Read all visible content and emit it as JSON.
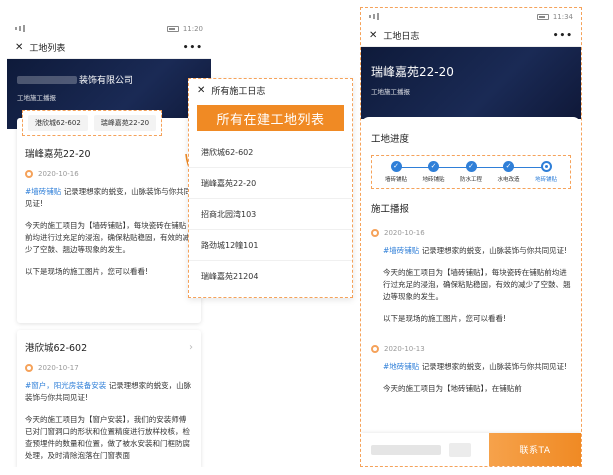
{
  "phone1": {
    "status_time": "11:20",
    "nav": {
      "close": "✕",
      "title": "工地列表",
      "more": "•••"
    },
    "banner": {
      "company": "装饰有限公司",
      "subtitle": "工地施工播报"
    },
    "chips": [
      "港欣城62-602",
      "瑞峰嘉苑22-20"
    ],
    "card1": {
      "title": "瑞峰嘉苑22-20",
      "date": "2020-10-16",
      "tag": "#墙砖铺贴",
      "tag_text": "记录理想家的蜕变，山脉装饰与你共同见证!",
      "line1": "你共同见证!",
      "para": "今天的施工项目为【墙砖铺贴】，每块瓷砖在铺贴前均进行过充足的浸泡，确保粘贴稳固，有效的减少了空鼓、翘边等现象的发生。",
      "para2": "以下是现场的施工图片，您可以看看!"
    },
    "card2": {
      "title": "港欣城62-602",
      "arrow": "›",
      "date": "2020-10-17",
      "tag": "#窗户，阳光房装备安装",
      "tag_text": "记录理想家的蜕变，山脉装饰与你共同见证!",
      "para": "今天的施工项目为【窗户安装】，我们的安装师傅已对门窗洞口的形状和位置精度进行放样校核，检查预埋件的数量和位置，做了被水安装和门框防腐处理，及时清除泡落在门窗表面"
    }
  },
  "popup": {
    "nav": {
      "close": "✕",
      "title": "所有施工日志"
    },
    "banner": "所有在建工地列表",
    "items": [
      "港欣城62-602",
      "瑞峰嘉苑22-20",
      "招商北园湾103",
      "路劲城12幢101",
      "瑞峰嘉苑21204"
    ]
  },
  "phone2": {
    "status_time": "11:34",
    "nav": {
      "close": "✕",
      "title": "工地日志",
      "more": "•••"
    },
    "banner": {
      "title": "瑞峰嘉苑22-20",
      "subtitle": "工地施工播报"
    },
    "progress_title": "工地进度",
    "steps": [
      {
        "label": "墙砖铺贴",
        "state": "done"
      },
      {
        "label": "地砖铺贴",
        "state": "done"
      },
      {
        "label": "防水工程",
        "state": "done"
      },
      {
        "label": "水电改造",
        "state": "done"
      },
      {
        "label": "地砖铺贴",
        "state": "current"
      }
    ],
    "broadcast_title": "施工播报",
    "post1": {
      "date": "2020-10-16",
      "tag": "#墙砖铺贴",
      "tag_text": "记录理想家的蜕变，山脉装饰与你共同见证!",
      "para": "今天的施工项目为【墙砖铺贴】，每块瓷砖在铺贴前均进行过充足的浸泡，确保粘贴稳固，有效的减少了空鼓、翘边等现象的发生。",
      "para2": "以下是现场的施工图片，您可以看看!"
    },
    "post2": {
      "date": "2020-10-13",
      "tag": "#地砖铺贴",
      "tag_text": "记录理想家的蜕变，山脉装饰与你共同见证!",
      "para": "今天的施工项目为【地砖铺贴】，在铺贴前"
    },
    "contact": "联系TA"
  },
  "colors": {
    "accent": "#f08a24",
    "link": "#2f7fd8",
    "banner": "#0e1a3a"
  }
}
